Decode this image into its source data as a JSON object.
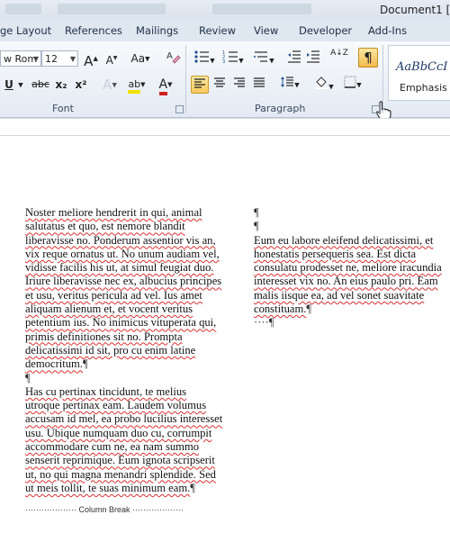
{
  "window": {
    "title": "Document1 [C"
  },
  "tabs": [
    "ge Layout",
    "References",
    "Mailings",
    "Review",
    "View",
    "Developer",
    "Add-Ins"
  ],
  "font_group": {
    "font_name": "w Rom",
    "font_size": "12",
    "grow_label": "A",
    "shrink_label": "A",
    "case_label": "Aa",
    "underline_label": "U",
    "strike_label": "abc",
    "subscript_label": "x₂",
    "superscript_label": "x²",
    "effects_label": "A",
    "highlight_label": "ab",
    "color_label": "A",
    "group_label": "Font"
  },
  "paragraph_group": {
    "group_label": "Paragraph",
    "sort_label": "A↓Z",
    "show_marks_label": "¶"
  },
  "styles": {
    "sample": "AaBbCcI",
    "name": "Emphasis"
  },
  "colors": {
    "highlight": "#f0e000",
    "font_color": "#d0201c",
    "accent": "#f7c95a"
  },
  "document": {
    "left_column": {
      "para1": "Noster meliore hendrerit in qui, animal salutatus et quo, est nemore blandit liberavisse no. Ponderum assentior vis an, vix reque ornatus ut. No unum audiam vel, vidisse facilis his ut, at simul feugiat duo. Iriure liberavisse nec ex, albucius principes et usu, veritus pericula ad vel. Ius amet aliquam alienum et, et vocent veritus petentium ius. No inimicus vituperata qui, primis definitiones sit no. Prompta delicatissimi id sit, pro cu enim latine democritum.",
      "para2": "Has cu pertinax tincidunt, te melius utroque pertinax eam. Laudem volumus accusam id mel, ea probo lucilius interesset usu. Ubique numquam duo cu, corrumpit accommodare cum ne, ea nam summo senserit reprimique. Eum ignota scripserit ut, no qui magna menandri splendide. Sed ut meis tollit, te suas minimum eam.",
      "pilcrow": "¶",
      "column_break": "··················· Column Break ···················"
    },
    "right_column": {
      "para1": "Eum eu labore eleifend delicatissimi, et honestatis persequeris sea. Est dicta consulatu prodesset ne, meliore iracundia interesset vix no. An eius paulo pri. Eam malis iisque ea, ad vel sonet suavitate constituam.",
      "pilcrow": "¶",
      "tail": "····¶"
    }
  }
}
